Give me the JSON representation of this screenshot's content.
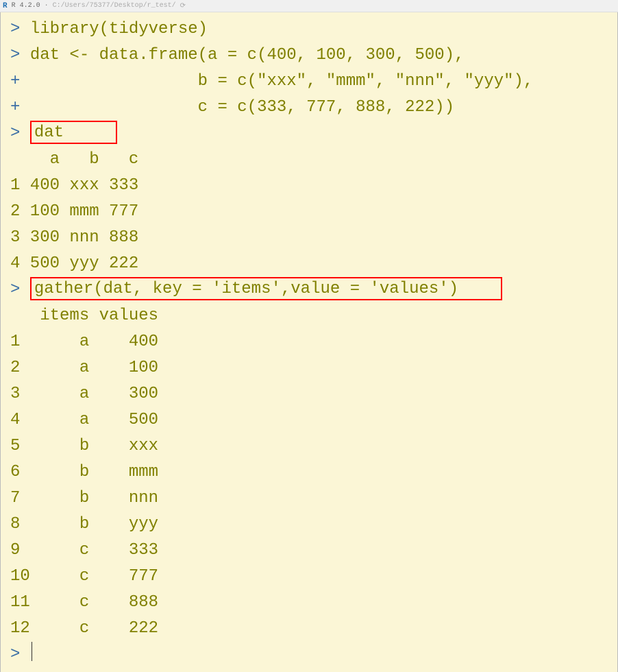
{
  "titlebar": {
    "icon_label": "R",
    "version": "R 4.2.0",
    "bullet": "·",
    "path": "C:/Users/75377/Desktop/r_test/",
    "arrow": "⟳"
  },
  "lines": {
    "l0_prompt": "> ",
    "l0_cmd": "library(tidyverse)",
    "l1_prompt": "> ",
    "l1_cmd": "dat <- data.frame(a = c(400, 100, 300, 500),",
    "l2_prompt": "+ ",
    "l2_cmd": "                 b = c(\"xxx\", \"mmm\", \"nnn\", \"yyy\"),",
    "l3_prompt": "+ ",
    "l3_cmd": "                 c = c(333, 777, 888, 222))",
    "l4_prompt": "> ",
    "l4_box": "dat     ",
    "l5": "    a   b   c",
    "l6": "1 400 xxx 333",
    "l7": "2 100 mmm 777",
    "l8": "3 300 nnn 888",
    "l9": "4 500 yyy 222",
    "l10_prompt": "> ",
    "l10_box": "gather(dat, key = 'items',value = 'values')    ",
    "l11": "   items values",
    "l12": "1      a    400",
    "l13": "2      a    100",
    "l14": "3      a    300",
    "l15": "4      a    500",
    "l16": "5      b    xxx",
    "l17": "6      b    mmm",
    "l18": "7      b    nnn",
    "l19": "8      b    yyy",
    "l20": "9      c    333",
    "l21": "10     c    777",
    "l22": "11     c    888",
    "l23": "12     c    222",
    "l24_prompt": "> "
  }
}
